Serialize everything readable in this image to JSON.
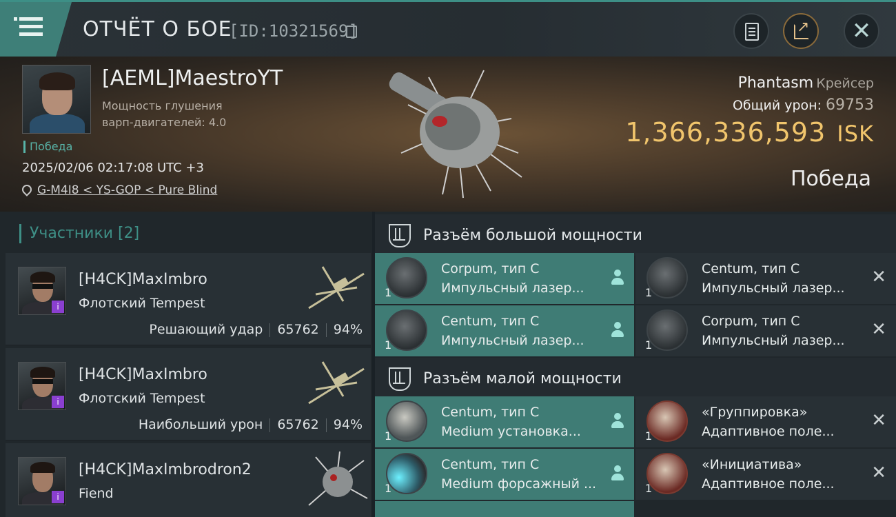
{
  "header": {
    "title": "ОТЧЁТ О БОЕ",
    "report_id": "[ID:10321569]",
    "icons": [
      "menu-icon",
      "copy-icon",
      "document-icon",
      "share-icon",
      "close-icon"
    ]
  },
  "hero": {
    "pilot_name": "[AEML]MaestroYT",
    "jam_label": "Мощность глушения варп-двигателей: 4.0",
    "victory_tag": "Победа",
    "datetime": "2025/02/06 02:17:08 UTC +3",
    "location": "G-M4I8 < YS-GOP < Pure Blind",
    "ship_name": "Phantasm",
    "ship_class": "Крейсер",
    "total_damage_label": "Общий урон:",
    "total_damage": "69753",
    "isk_value": "1,366,336,593",
    "isk_unit": "ISK",
    "result": "Победа"
  },
  "participants": {
    "title": "Участники [2]",
    "items": [
      {
        "name": "[H4CK]MaxImbro",
        "ship": "Флотский Tempest",
        "role": "Решающий удар",
        "damage": "65762",
        "percent": "94%"
      },
      {
        "name": "[H4CK]MaxImbro",
        "ship": "Флотский Tempest",
        "role": "Наибольший урон",
        "damage": "65762",
        "percent": "94%"
      },
      {
        "name": "[H4CK]MaxImbrodron2",
        "ship": "Fiend",
        "role": "",
        "damage": "",
        "percent": ""
      }
    ]
  },
  "slots": {
    "high": {
      "title": "Разъём большой мощности",
      "modules": [
        {
          "qty": "1",
          "name": "Corpum, тип C",
          "type": "Импульсный лазер...",
          "status": "fitted"
        },
        {
          "qty": "1",
          "name": "Centum, тип C",
          "type": "Импульсный лазер...",
          "status": "destroyed"
        },
        {
          "qty": "1",
          "name": "Centum, тип C",
          "type": "Импульсный лазер...",
          "status": "fitted"
        },
        {
          "qty": "1",
          "name": "Corpum, тип C",
          "type": "Импульсный лазер...",
          "status": "destroyed"
        }
      ]
    },
    "mid": {
      "title": "Разъём малой мощности",
      "modules": [
        {
          "qty": "1",
          "name": "Centum, тип C",
          "type": "Medium установка...",
          "status": "fitted"
        },
        {
          "qty": "1",
          "name": "«Группировка»",
          "type": "Адаптивное поле...",
          "status": "destroyed"
        },
        {
          "qty": "1",
          "name": "Centum, тип C",
          "type": "Medium форсажный ...",
          "status": "fitted"
        },
        {
          "qty": "1",
          "name": "«Инициатива»",
          "type": "Адаптивное поле...",
          "status": "destroyed"
        }
      ]
    }
  },
  "colors": {
    "accent": "#3e8f86",
    "isk": "#f1c56c",
    "fitted_bg": "#3f7c75",
    "destroyed_bg": "#283035",
    "corp_badge": "#8a3fd0"
  }
}
